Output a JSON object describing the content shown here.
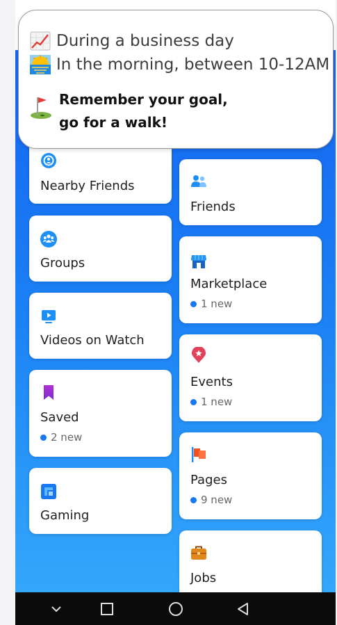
{
  "notification": {
    "line1_text": "During a business day",
    "line1_icon": "chart-increasing-icon",
    "line2_text": "In the morning, between 10-12AM",
    "line2_icon": "sunrise-icon",
    "goal_icon": "golf-flag-icon",
    "goal_line1": "Remember your goal,",
    "goal_line2": "go for a walk!"
  },
  "shortcuts": {
    "left": [
      {
        "label": "Nearby Friends",
        "icon": "nearby-friends-icon",
        "badge": ""
      },
      {
        "label": "Groups",
        "icon": "groups-icon",
        "badge": ""
      },
      {
        "label": "Videos on Watch",
        "icon": "watch-video-icon",
        "badge": ""
      },
      {
        "label": "Saved",
        "icon": "bookmark-icon",
        "badge": "2 new"
      },
      {
        "label": "Gaming",
        "icon": "gaming-icon",
        "badge": ""
      }
    ],
    "right": [
      {
        "label": "Friends",
        "icon": "friends-icon",
        "badge": ""
      },
      {
        "label": "Marketplace",
        "icon": "marketplace-icon",
        "badge": "1 new"
      },
      {
        "label": "Events",
        "icon": "events-icon",
        "badge": "1 new"
      },
      {
        "label": "Pages",
        "icon": "flag-icon",
        "badge": "9 new"
      },
      {
        "label": "Jobs",
        "icon": "briefcase-icon",
        "badge": ""
      }
    ]
  },
  "navbar": {
    "buttons": [
      "hide-keyboard-icon",
      "recent-apps-icon",
      "home-icon",
      "back-icon"
    ]
  },
  "colors": {
    "gradient_top": "#1565f0",
    "gradient_bottom": "#34a8fb",
    "badge_dot": "#1877f2"
  }
}
